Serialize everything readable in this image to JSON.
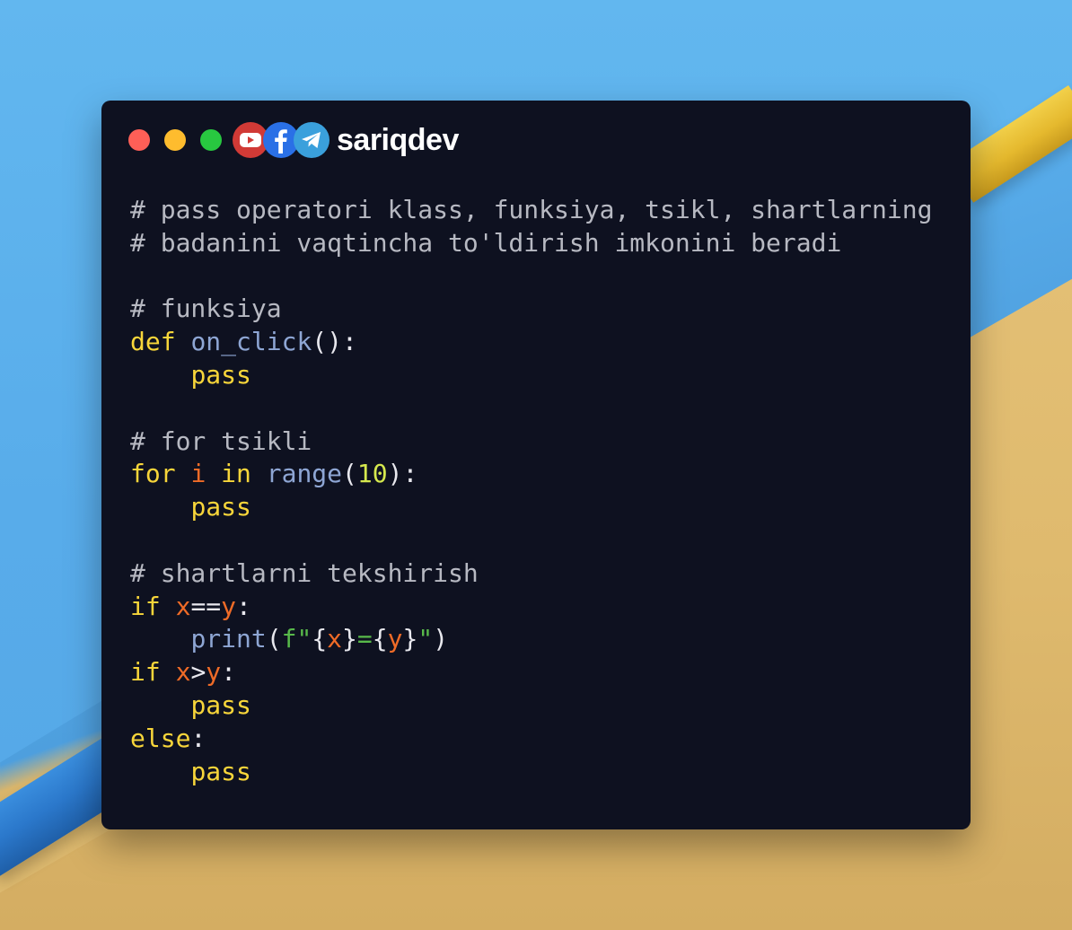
{
  "window": {
    "brand": "sariqdev",
    "social_icons": [
      "youtube-icon",
      "facebook-icon",
      "telegram-icon"
    ],
    "traffic_light_colors": [
      "#fe5f57",
      "#febc2e",
      "#28c840"
    ]
  },
  "code": {
    "lines": [
      [
        {
          "t": "# pass operatori klass, funksiya, tsikl, shartlarning",
          "k": "comment"
        }
      ],
      [
        {
          "t": "# badanini vaqtincha to'ldirish imkonini beradi",
          "k": "comment"
        }
      ],
      [],
      [
        {
          "t": "# funksiya",
          "k": "comment"
        }
      ],
      [
        {
          "t": "def",
          "k": "kw"
        },
        {
          "t": " ",
          "k": "p"
        },
        {
          "t": "on_click",
          "k": "fn"
        },
        {
          "t": "():",
          "k": "p"
        }
      ],
      [
        {
          "t": "    ",
          "k": "p"
        },
        {
          "t": "pass",
          "k": "kw"
        }
      ],
      [],
      [
        {
          "t": "# for tsikli",
          "k": "comment"
        }
      ],
      [
        {
          "t": "for",
          "k": "kw"
        },
        {
          "t": " ",
          "k": "p"
        },
        {
          "t": "i",
          "k": "var"
        },
        {
          "t": " ",
          "k": "p"
        },
        {
          "t": "in",
          "k": "kw"
        },
        {
          "t": " ",
          "k": "p"
        },
        {
          "t": "range",
          "k": "fn"
        },
        {
          "t": "(",
          "k": "p"
        },
        {
          "t": "10",
          "k": "num"
        },
        {
          "t": "):",
          "k": "p"
        }
      ],
      [
        {
          "t": "    ",
          "k": "p"
        },
        {
          "t": "pass",
          "k": "kw"
        }
      ],
      [],
      [
        {
          "t": "# shartlarni tekshirish",
          "k": "comment"
        }
      ],
      [
        {
          "t": "if",
          "k": "kw"
        },
        {
          "t": " ",
          "k": "p"
        },
        {
          "t": "x",
          "k": "var"
        },
        {
          "t": "==",
          "k": "p"
        },
        {
          "t": "y",
          "k": "var"
        },
        {
          "t": ":",
          "k": "p"
        }
      ],
      [
        {
          "t": "    ",
          "k": "p"
        },
        {
          "t": "print",
          "k": "fn"
        },
        {
          "t": "(",
          "k": "p"
        },
        {
          "t": "f\"",
          "k": "str"
        },
        {
          "t": "{",
          "k": "p"
        },
        {
          "t": "x",
          "k": "var"
        },
        {
          "t": "}",
          "k": "p"
        },
        {
          "t": "=",
          "k": "str"
        },
        {
          "t": "{",
          "k": "p"
        },
        {
          "t": "y",
          "k": "var"
        },
        {
          "t": "}",
          "k": "p"
        },
        {
          "t": "\"",
          "k": "str"
        },
        {
          "t": ")",
          "k": "p"
        }
      ],
      [
        {
          "t": "if",
          "k": "kw"
        },
        {
          "t": " ",
          "k": "p"
        },
        {
          "t": "x",
          "k": "var"
        },
        {
          "t": ">",
          "k": "p"
        },
        {
          "t": "y",
          "k": "var"
        },
        {
          "t": ":",
          "k": "p"
        }
      ],
      [
        {
          "t": "    ",
          "k": "p"
        },
        {
          "t": "pass",
          "k": "kw"
        }
      ],
      [
        {
          "t": "else",
          "k": "kw"
        },
        {
          "t": ":",
          "k": "p"
        }
      ],
      [
        {
          "t": "    ",
          "k": "p"
        },
        {
          "t": "pass",
          "k": "kw"
        }
      ]
    ]
  },
  "colors": {
    "comment": "#b7b9c2",
    "keyword": "#f7d53a",
    "function": "#8ea6d4",
    "variable": "#ef6b27",
    "number": "#d5e84e",
    "string": "#58b94a",
    "punctuation": "#e8e8ee",
    "background": "#0e1120"
  }
}
